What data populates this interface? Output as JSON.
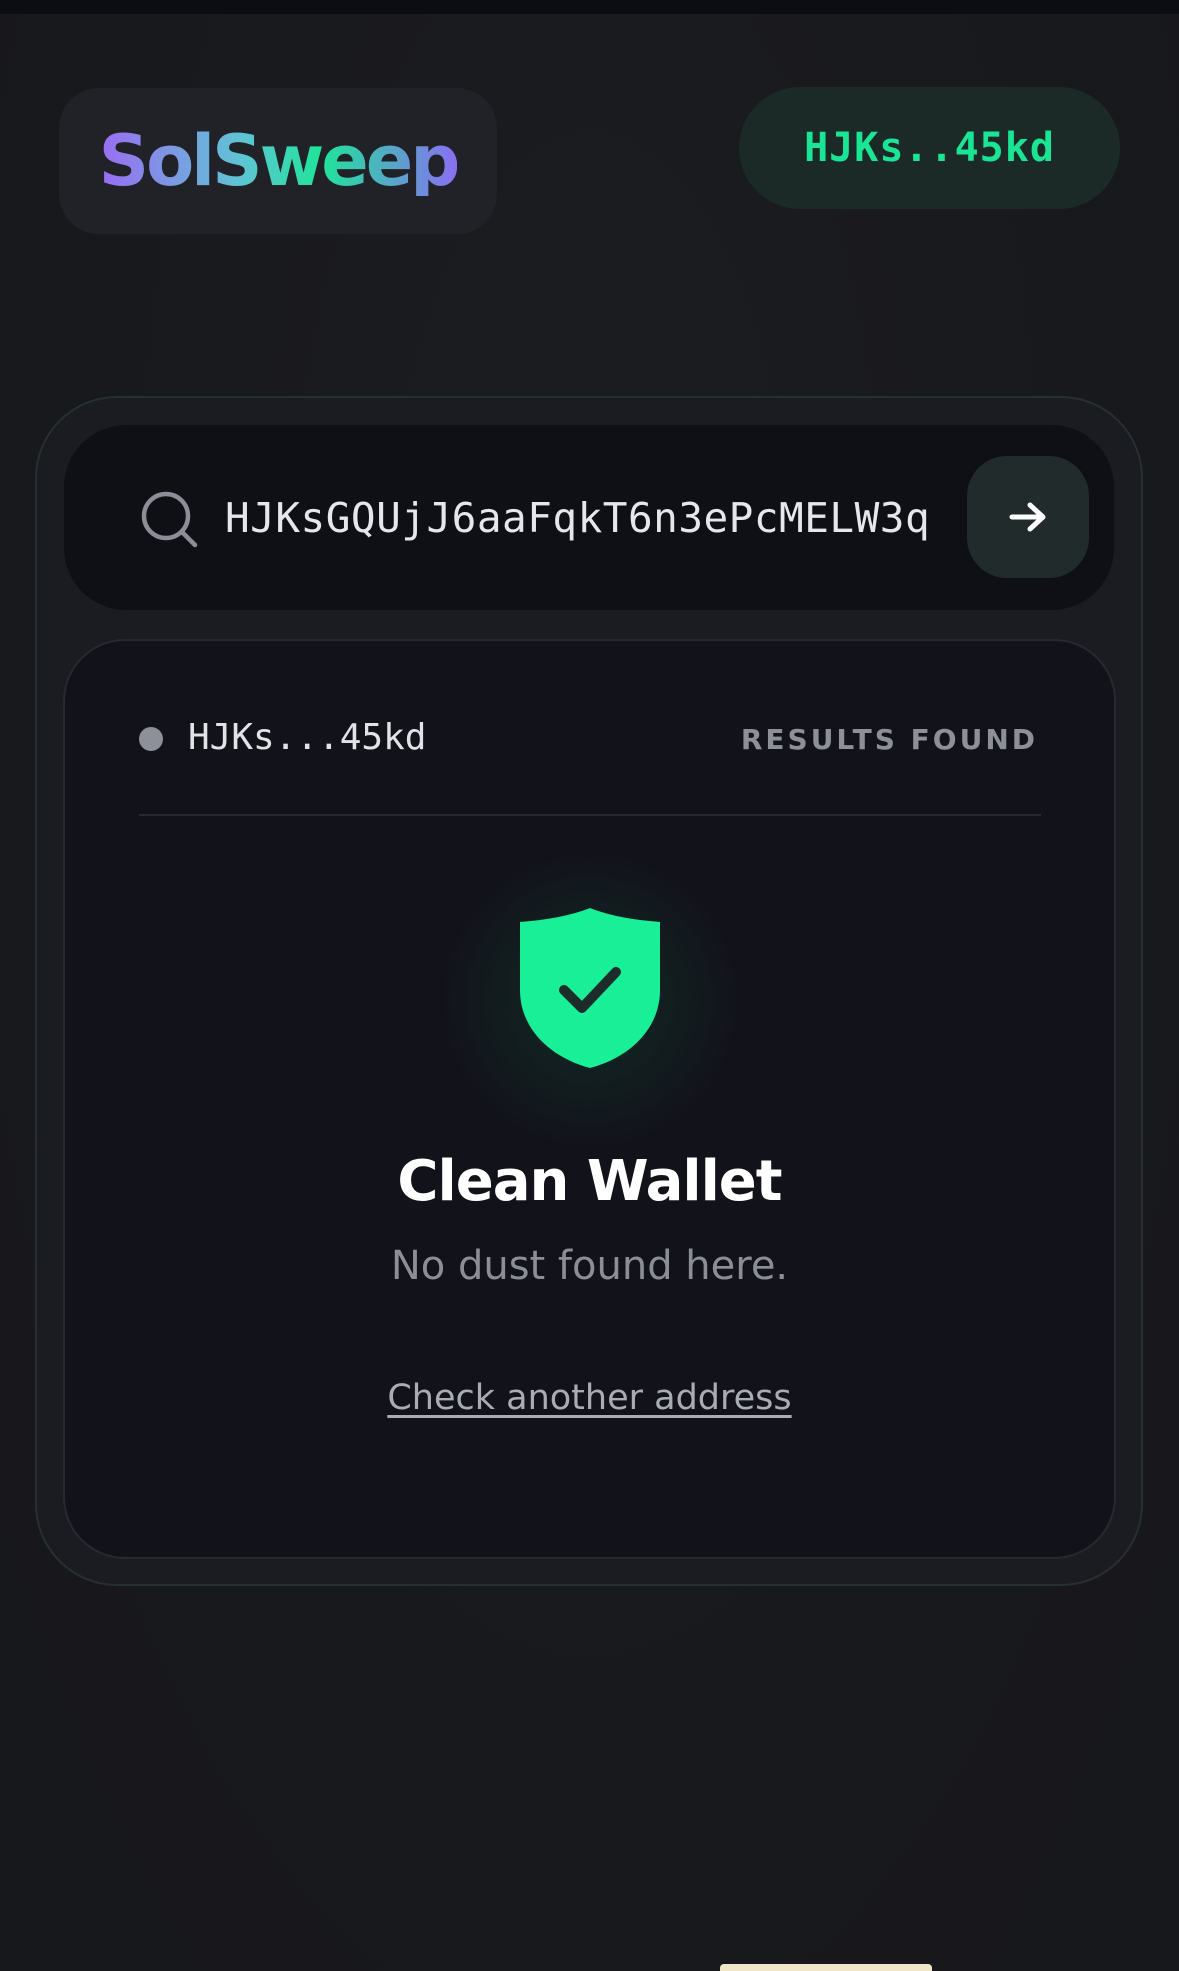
{
  "header": {
    "logo_text": "SolSweep",
    "wallet_short": "HJKs..45kd"
  },
  "search": {
    "value": "HJKsGQUjJ6aaFqkT6n3ePcMELW3q",
    "icon": "search-icon",
    "submit_icon": "arrow-right-icon"
  },
  "result": {
    "address_short": "HJKs...45kd",
    "status_label": "RESULTS FOUND",
    "icon": "shield-check-icon",
    "title": "Clean Wallet",
    "subtitle": "No dust found here.",
    "link_label": "Check another address"
  },
  "colors": {
    "background": "#18191d",
    "accent_green": "#19e595",
    "logo_purple": "#9b6cf3",
    "card": "#12131a",
    "muted_text": "#8b8e96"
  }
}
